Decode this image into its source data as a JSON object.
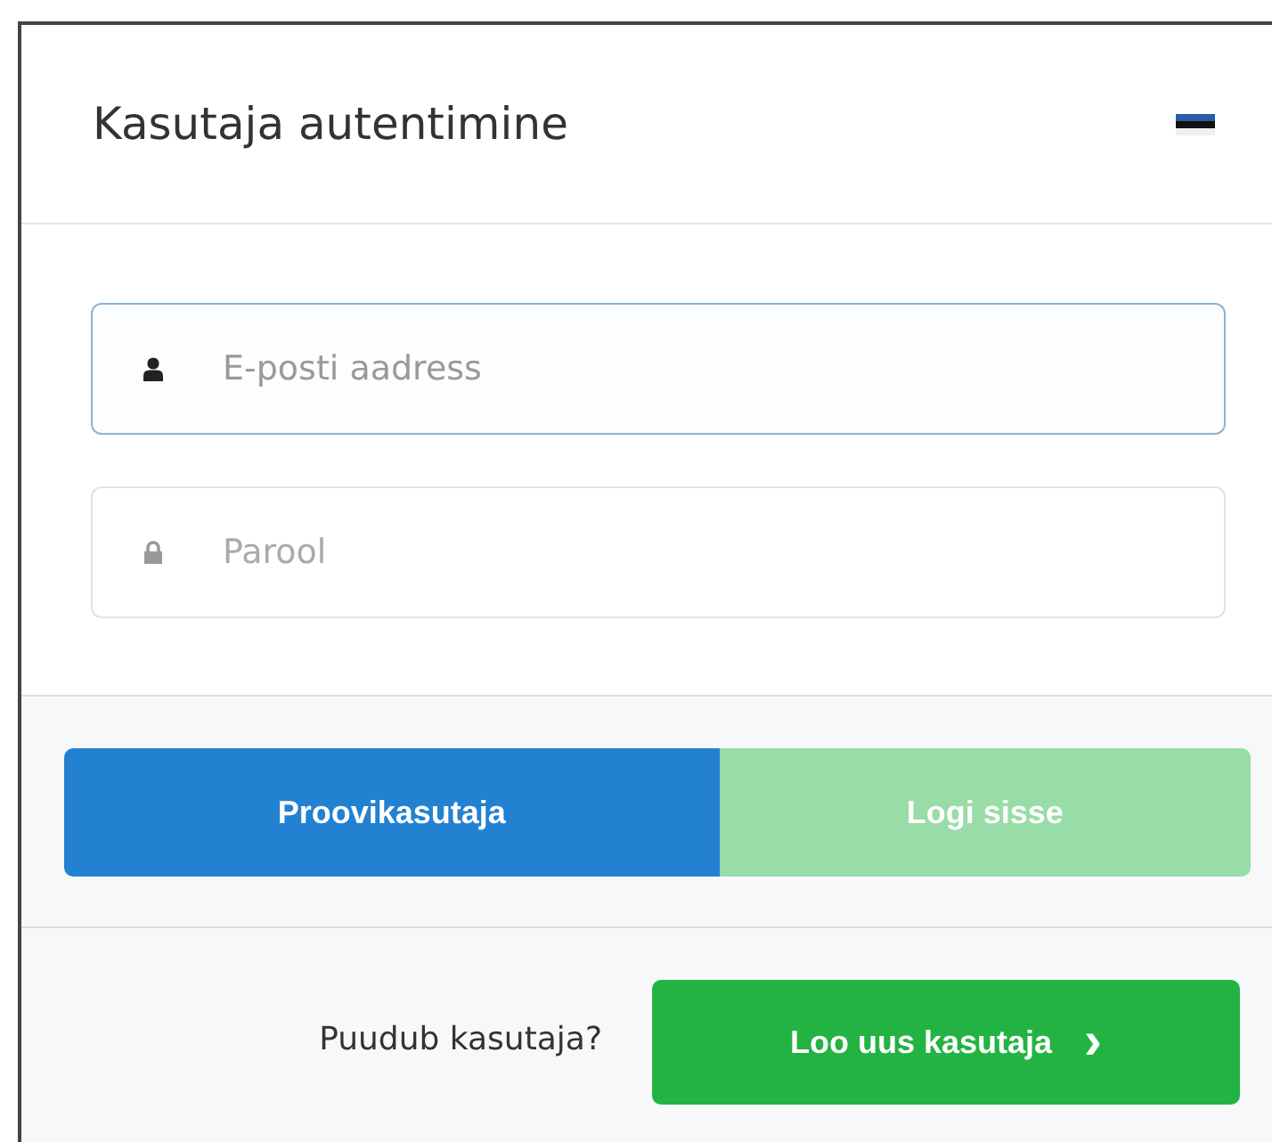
{
  "panel": {
    "title": "Kasutaja autentimine"
  },
  "fields": [
    {
      "kind": "user",
      "placeholder": "E-posti aadress",
      "focused": true
    },
    {
      "kind": "lock",
      "placeholder": "Parool",
      "focused": false
    }
  ],
  "actions": [
    {
      "label": "Proovikasutaja",
      "kind": "primary",
      "disabled": false
    },
    {
      "label": "Logi sisse",
      "kind": "success",
      "disabled": true
    }
  ],
  "footer": {
    "text": "Puudub kasutaja?",
    "button": {
      "label": "Loo uus kasutaja",
      "icon": "›"
    }
  }
}
